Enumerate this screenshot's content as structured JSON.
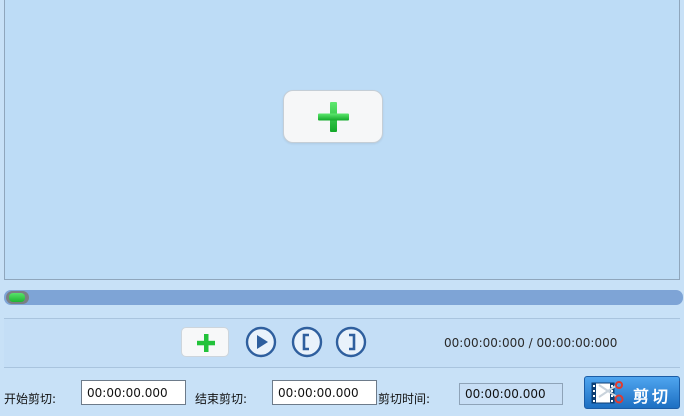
{
  "preview": {
    "add_media_icon": "plus-icon"
  },
  "playback": {
    "progress_fraction": 0.0,
    "current_time": "00:00:00:000",
    "separator": " / ",
    "total_time": "00:00:00:000"
  },
  "controls": {
    "add_icon": "plus-icon",
    "play_icon": "play-icon",
    "mark_start_icon": "bracket-left-icon",
    "mark_end_icon": "bracket-right-icon"
  },
  "cut_settings": {
    "start_label": "开始剪切:",
    "start_value": "00:00:00.000",
    "end_label": "结束剪切:",
    "end_value": "00:00:00.000",
    "duration_label": "剪切时间:",
    "duration_value": "00:00:00.000",
    "cut_button_label": "剪切"
  },
  "colors": {
    "accent": "#1d6fc2",
    "plus_green": "#1fbf33",
    "control_blue": "#2f5f9e"
  }
}
